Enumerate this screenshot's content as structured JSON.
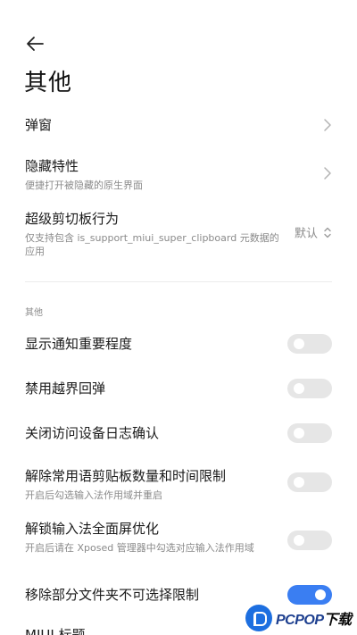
{
  "header": {
    "title": "其他"
  },
  "items": [
    {
      "title": "弹窗",
      "subtitle": "",
      "control": "chevron"
    },
    {
      "title": "隐藏特性",
      "subtitle": "便捷打开被隐藏的原生界面",
      "control": "chevron"
    },
    {
      "title": "超级剪切板行为",
      "subtitle": "仅支持包含 is_support_miui_super_clipboard 元数据的应用",
      "control": "select",
      "value": "默认"
    }
  ],
  "section": {
    "label": "其他"
  },
  "toggles": [
    {
      "title": "显示通知重要程度",
      "subtitle": "",
      "on": false
    },
    {
      "title": "禁用越界回弹",
      "subtitle": "",
      "on": false
    },
    {
      "title": "关闭访问设备日志确认",
      "subtitle": "",
      "on": false
    },
    {
      "title": "解除常用语剪贴板数量和时间限制",
      "subtitle": "开启后勾选输入法作用域并重启",
      "on": false
    },
    {
      "title": "解锁输入法全面屏优化",
      "subtitle": "开启后请在 Xposed 管理器中勾选对应输入法作用域",
      "on": false
    },
    {
      "title": "移除部分文件夹不可选择限制",
      "subtitle": "",
      "on": true
    }
  ],
  "partial_next": {
    "title": "MIUI 标题"
  },
  "watermark": {
    "brand": "PCPOP",
    "suffix": "下载"
  },
  "colors": {
    "accent": "#3a7ef2",
    "switch_off": "#e6e6e6"
  }
}
